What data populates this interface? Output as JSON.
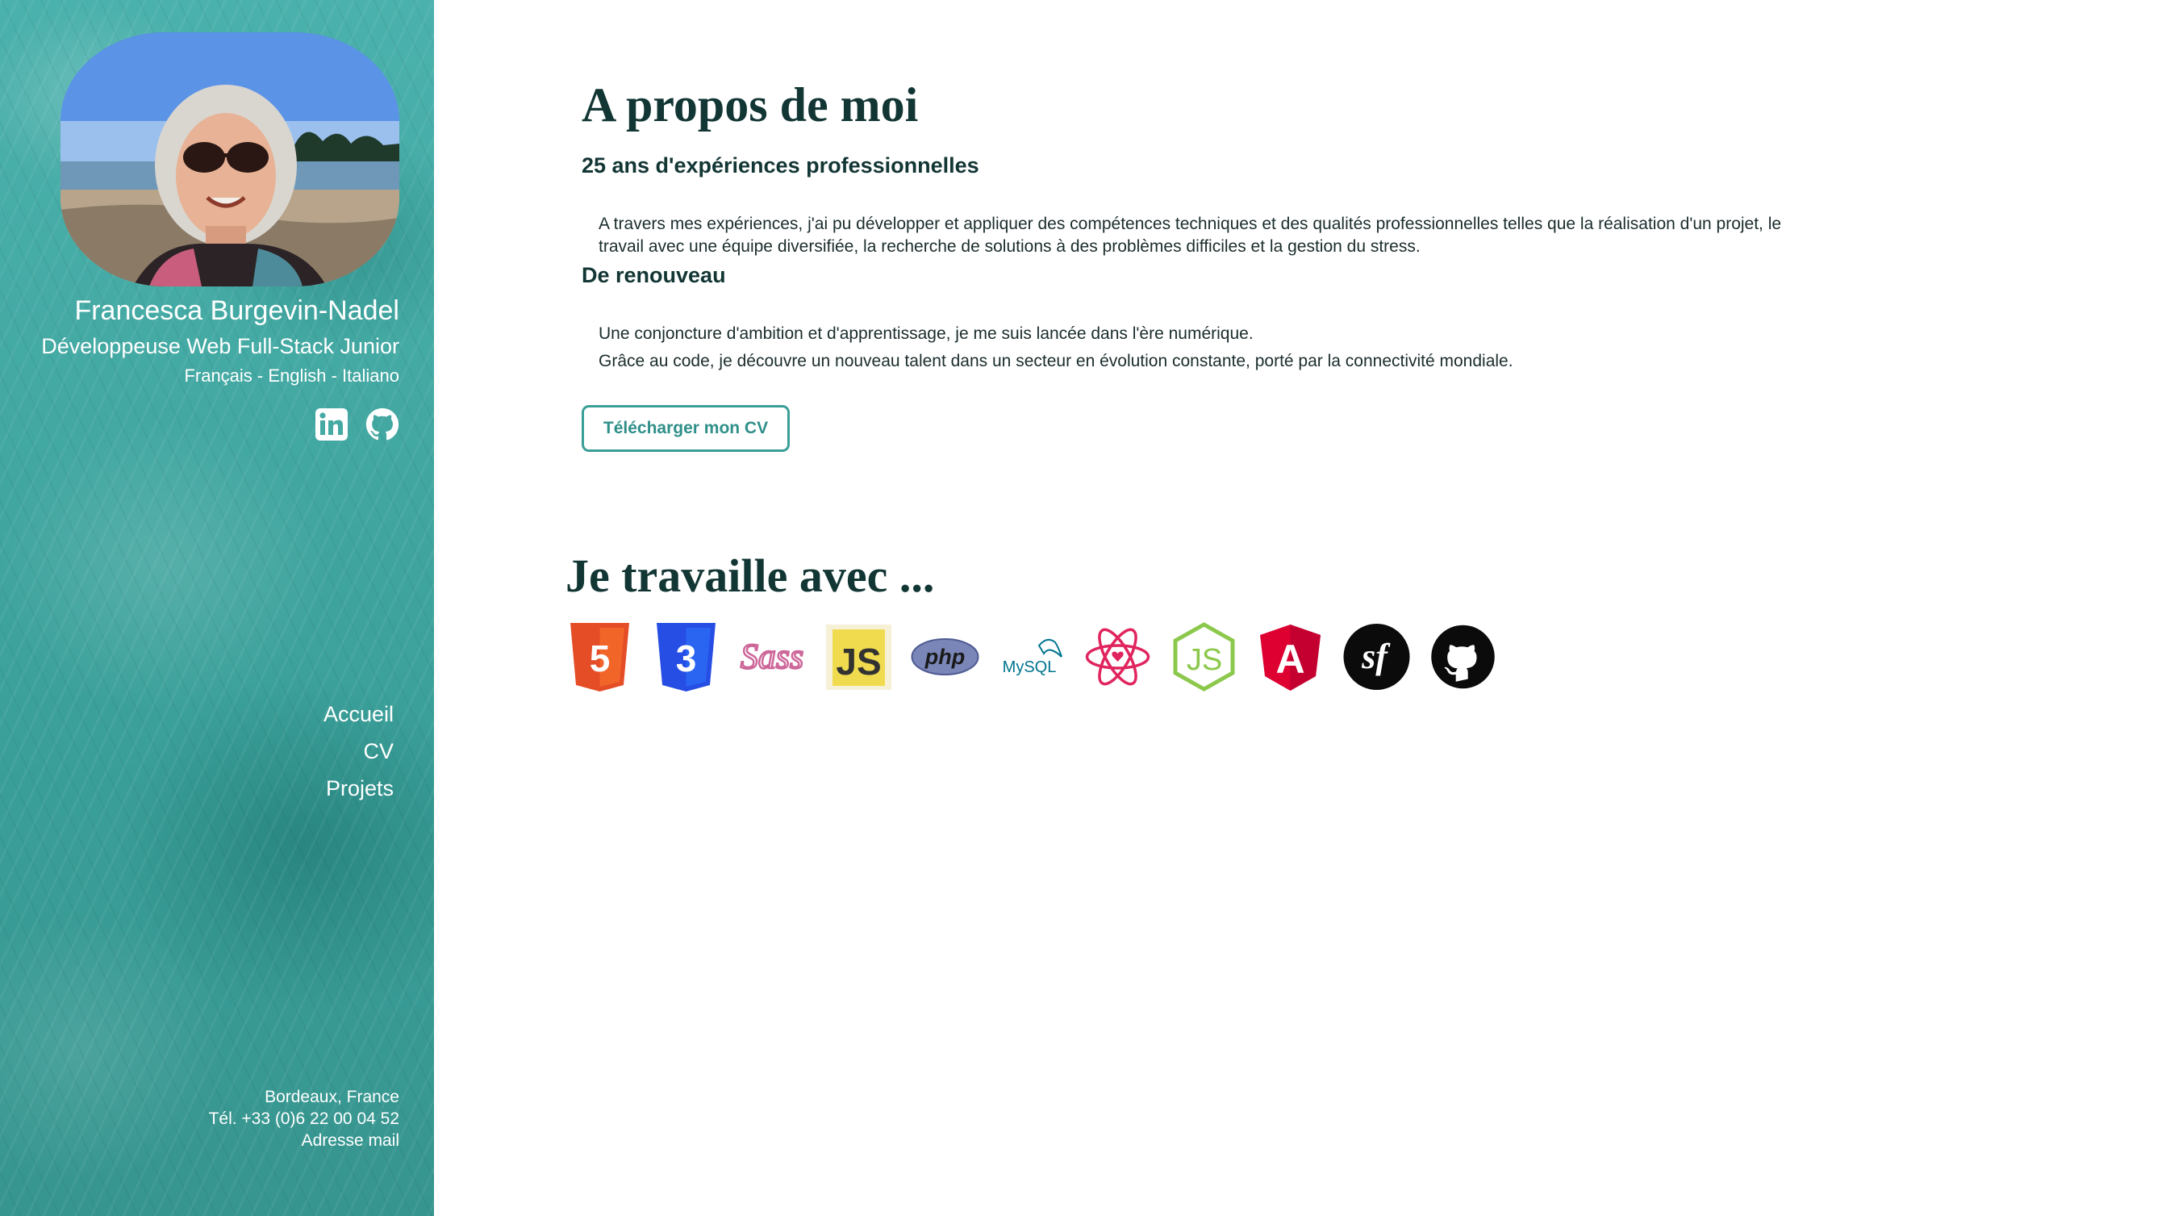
{
  "sidebar": {
    "name": "Francesca Burgevin-Nadel",
    "role": "Développeuse Web Full-Stack Junior",
    "languages": "Français - English - Italiano",
    "social": [
      {
        "icon": "linkedin-icon",
        "label": "LinkedIn"
      },
      {
        "icon": "github-icon",
        "label": "GitHub"
      }
    ],
    "nav": [
      {
        "label": "Accueil"
      },
      {
        "label": "CV"
      },
      {
        "label": "Projets"
      }
    ],
    "contact": {
      "city": "Bordeaux, France",
      "phone": "Tél. +33 (0)6 22 00 04 52",
      "email_label": "Adresse mail"
    }
  },
  "main": {
    "about_title": "A propos de moi",
    "section1": {
      "title": "25 ans d'expériences professionnelles",
      "text": "A travers mes expériences, j'ai pu développer et appliquer des compétences techniques et des qualités professionnelles telles que la réalisation d'un projet, le travail avec une équipe diversifiée, la recherche de solutions à des problèmes difficiles et la gestion du stress."
    },
    "section2": {
      "title": "De renouveau",
      "line1": "Une conjoncture d'ambition et d'apprentissage, je me suis lancée dans l'ère numérique.",
      "line2": "Grâce au code, je découvre un nouveau talent dans un secteur en évolution constante, porté par la connectivité mondiale."
    },
    "cv_button": "Télécharger mon CV",
    "techs_title": "Je travaille avec ...",
    "techs": [
      {
        "icon": "html5-icon",
        "label": "5"
      },
      {
        "icon": "css3-icon",
        "label": "3"
      },
      {
        "icon": "sass-icon",
        "label": "Sass"
      },
      {
        "icon": "javascript-icon",
        "label": "JS"
      },
      {
        "icon": "php-icon",
        "label": "php"
      },
      {
        "icon": "mysql-icon",
        "label": "MySQL"
      },
      {
        "icon": "react-icon",
        "label": ""
      },
      {
        "icon": "nodejs-icon",
        "label": "JS"
      },
      {
        "icon": "angular-icon",
        "label": "A"
      },
      {
        "icon": "symfony-icon",
        "label": "sf"
      },
      {
        "icon": "github-icon",
        "label": ""
      }
    ]
  },
  "colors": {
    "accent": "#3a9e98",
    "heading": "#123634",
    "html5": "#e44d26",
    "css3": "#264de4",
    "sass": "#cd6799",
    "js": "#f0db4f",
    "php": "#7a86b8",
    "react": "#e0245e",
    "node": "#8cc84b",
    "angular": "#dd0031"
  }
}
